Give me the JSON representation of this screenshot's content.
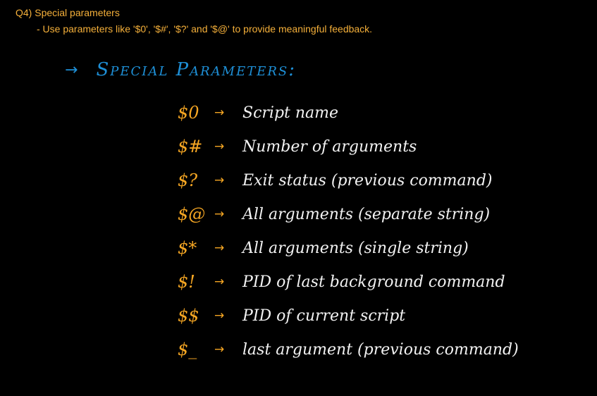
{
  "header": {
    "question_title": "Q4) Special parameters",
    "question_description": "- Use parameters like '$0', '$#', '$?' and '$@' to provide meaningful feedback."
  },
  "notes": {
    "heading_arrow": "→",
    "heading": "Special Parameters:",
    "params": [
      {
        "symbol": "$0",
        "arrow": "→",
        "description": "Script name"
      },
      {
        "symbol": "$#",
        "arrow": "→",
        "description": "Number of arguments"
      },
      {
        "symbol": "$?",
        "arrow": "→",
        "description": "Exit status (previous command)"
      },
      {
        "symbol": "$@",
        "arrow": "→",
        "description": "All arguments (separate string)"
      },
      {
        "symbol": "$*",
        "arrow": "→",
        "description": "All arguments (single string)"
      },
      {
        "symbol": "$!",
        "arrow": "→",
        "description": "PID of last background command"
      },
      {
        "symbol": "$$",
        "arrow": "→",
        "description": "PID of current script"
      },
      {
        "symbol": "$_",
        "arrow": "→",
        "description": "last argument (previous command)"
      }
    ]
  },
  "colors": {
    "background": "#000000",
    "header_text": "#f5b03a",
    "heading": "#1e8fd6",
    "symbol": "#f5a623",
    "description": "#f2f2f2"
  }
}
